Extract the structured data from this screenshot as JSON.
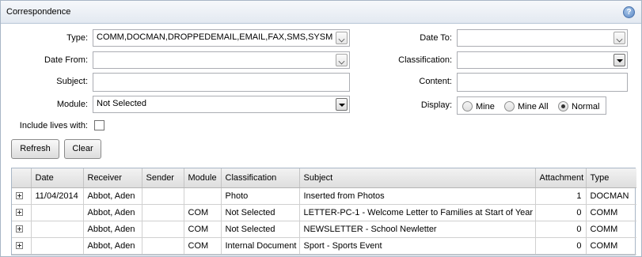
{
  "panel": {
    "title": "Correspondence",
    "help_label": "?"
  },
  "filters": {
    "type_label": "Type:",
    "type_value": "COMM,DOCMAN,DROPPEDEMAIL,EMAIL,FAX,SMS,SYSM",
    "date_from_label": "Date From:",
    "date_from_value": "",
    "subject_label": "Subject:",
    "subject_value": "",
    "module_label": "Module:",
    "module_value": "Not Selected",
    "include_lives_label": "Include lives with:",
    "date_to_label": "Date To:",
    "date_to_value": "",
    "classification_label": "Classification:",
    "classification_value": "",
    "content_label": "Content:",
    "content_value": "",
    "display_label": "Display:",
    "display_options": [
      "Mine",
      "Mine All",
      "Normal"
    ],
    "display_selected": "Normal"
  },
  "buttons": {
    "refresh": "Refresh",
    "clear": "Clear"
  },
  "grid": {
    "columns": [
      "",
      "Date",
      "Receiver",
      "Sender",
      "Module",
      "Classification",
      "Subject",
      "Attachment",
      "Type"
    ],
    "rows": [
      {
        "date": "11/04/2014",
        "receiver": "Abbot, Aden",
        "sender": "",
        "module": "",
        "classification": "Photo",
        "subject": "Inserted from Photos",
        "attachment": "1",
        "type": "DOCMAN"
      },
      {
        "date": "",
        "receiver": "Abbot, Aden",
        "sender": "",
        "module": "COM",
        "classification": "Not Selected",
        "subject": "LETTER-PC-1 - Welcome Letter to Families at Start of Year",
        "attachment": "0",
        "type": "COMM"
      },
      {
        "date": "",
        "receiver": "Abbot, Aden",
        "sender": "",
        "module": "COM",
        "classification": "Not Selected",
        "subject": "NEWSLETTER - School Newletter",
        "attachment": "0",
        "type": "COMM"
      },
      {
        "date": "",
        "receiver": "Abbot, Aden",
        "sender": "",
        "module": "COM",
        "classification": "Internal Document",
        "subject": "Sport - Sports Event",
        "attachment": "0",
        "type": "COMM"
      }
    ]
  }
}
